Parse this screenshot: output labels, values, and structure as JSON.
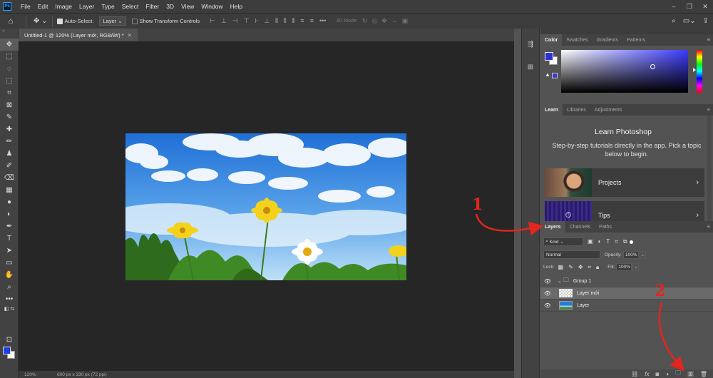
{
  "app": {
    "logo_text": "Ps",
    "menu": [
      "File",
      "Edit",
      "Image",
      "Layer",
      "Type",
      "Select",
      "Filter",
      "3D",
      "View",
      "Window",
      "Help"
    ],
    "window_controls": [
      "–",
      "❐",
      "✕"
    ]
  },
  "options_bar": {
    "auto_select_label": "Auto-Select:",
    "auto_select_value": "Layer",
    "transform_controls_label": "Show Transform Controls",
    "more_label": "•••",
    "mode_3d_label": "3D Mode:"
  },
  "document": {
    "tab_title": "Untitled-1 @ 120% (Layer mới, RGB/8#) *",
    "tab_close": "✕",
    "status_zoom": "120%",
    "status_info": "600 px x 330 px (72 ppi)"
  },
  "color_panel": {
    "tabs": [
      "Color",
      "Swatches",
      "Gradients",
      "Patterns"
    ],
    "foreground": "#2a32d8",
    "background": "#ffffff"
  },
  "learn_panel": {
    "tabs": [
      "Learn",
      "Libraries",
      "Adjustments"
    ],
    "title": "Learn Photoshop",
    "description": "Step-by-step tutorials directly in the app. Pick a topic below to begin.",
    "cards": [
      {
        "label": "Projects"
      },
      {
        "label": "Tips"
      }
    ]
  },
  "layers_panel": {
    "tabs": [
      "Layers",
      "Channels",
      "Paths"
    ],
    "filter_label": "Kind",
    "blend_mode": "Normal",
    "opacity_label": "Opacity:",
    "opacity_value": "100%",
    "lock_label": "Lock:",
    "fill_label": "Fill:",
    "fill_value": "100%",
    "layers": [
      {
        "name": "Group 1",
        "type": "group",
        "selected": false
      },
      {
        "name": "Layer mới",
        "type": "empty",
        "selected": true
      },
      {
        "name": "Layer",
        "type": "image",
        "selected": false
      }
    ],
    "footer_icons": [
      "link",
      "fx",
      "mask",
      "adjustment",
      "group",
      "new-layer",
      "trash"
    ]
  },
  "annotations": [
    "1",
    "2"
  ],
  "colors": {
    "annotation_red": "#e2261d",
    "ps_blue": "#31a8ff"
  }
}
